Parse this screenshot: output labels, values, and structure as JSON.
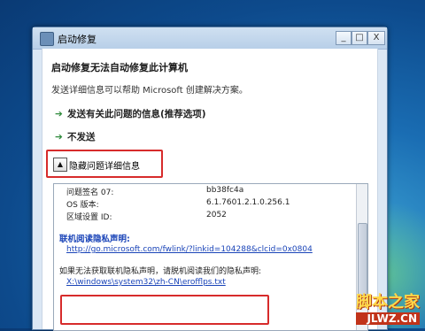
{
  "window": {
    "title": "启动修复",
    "controls": {
      "minimize": "_",
      "maximize": "□",
      "close": "X"
    }
  },
  "main": {
    "heading": "启动修复无法自动修复此计算机",
    "description": "发送详细信息可以帮助 Microsoft 创建解决方案。",
    "options": [
      {
        "label": "发送有关此问题的信息(推荐选项)"
      },
      {
        "label": "不发送"
      }
    ],
    "toggle_details_label": "隐藏问题详细信息",
    "toggle_arrow": "▲"
  },
  "details": {
    "partial_line": "问题签名 07:",
    "partial_value": "bb38fc4a",
    "rows": [
      {
        "key": "OS 版本:",
        "value": "6.1.7601.2.1.0.256.1"
      },
      {
        "key": "区域设置 ID:",
        "value": "2052"
      }
    ],
    "privacy_heading": "联机阅读隐私声明:",
    "privacy_link": "http://go.microsoft.com/fwlink/?linkid=104288&clcid=0x0804",
    "offline_text": "如果无法获取联机隐私声明，请脱机阅读我们的隐私声明:",
    "offline_link": "X:\\windows\\system32\\zh-CN\\erofflps.txt"
  },
  "watermark": {
    "main": "脚本之家",
    "url": "JLWZ.CN"
  }
}
